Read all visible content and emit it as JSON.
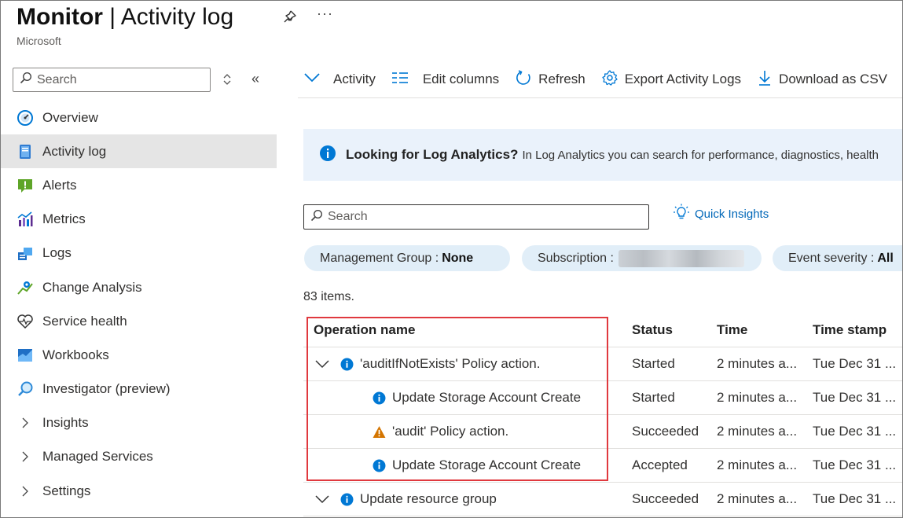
{
  "header": {
    "title_bold": "Monitor",
    "title_sep": " | ",
    "title_rest": "Activity log",
    "subtitle": "Microsoft",
    "more": "···"
  },
  "sidebar": {
    "search_placeholder": "Search",
    "collapse": "«",
    "items": [
      {
        "label": "Overview",
        "icon": "gauge-icon",
        "active": false
      },
      {
        "label": "Activity log",
        "icon": "activity-log-icon",
        "active": true
      },
      {
        "label": "Alerts",
        "icon": "alert-icon",
        "active": false
      },
      {
        "label": "Metrics",
        "icon": "metrics-icon",
        "active": false
      },
      {
        "label": "Logs",
        "icon": "logs-icon",
        "active": false
      },
      {
        "label": "Change Analysis",
        "icon": "change-analysis-icon",
        "active": false
      },
      {
        "label": "Service health",
        "icon": "heart-pulse-icon",
        "active": false
      },
      {
        "label": "Workbooks",
        "icon": "workbooks-icon",
        "active": false
      },
      {
        "label": "Investigator (preview)",
        "icon": "investigator-icon",
        "active": false
      },
      {
        "label": "Insights",
        "icon": "chevron-right-icon",
        "active": false
      },
      {
        "label": "Managed Services",
        "icon": "chevron-right-icon",
        "active": false
      },
      {
        "label": "Settings",
        "icon": "chevron-right-icon",
        "active": false
      }
    ]
  },
  "toolbar": {
    "activity": "Activity",
    "edit_columns": "Edit columns",
    "refresh": "Refresh",
    "export": "Export Activity Logs",
    "download": "Download as CSV"
  },
  "banner": {
    "bold": "Looking for Log Analytics?",
    "rest": "In Log Analytics you can search for performance, diagnostics, health"
  },
  "main": {
    "search_placeholder": "Search",
    "quick_insights": "Quick Insights",
    "filters": {
      "mgmt_label": "Management Group :",
      "mgmt_value": "None",
      "sub_label": "Subscription :",
      "sev_label": "Event severity :",
      "sev_value": "All"
    },
    "count": "83 items."
  },
  "table": {
    "columns": [
      "Operation name",
      "Status",
      "Time",
      "Time stamp"
    ],
    "rows": [
      {
        "op": "'auditIfNotExists' Policy action.",
        "status": "Started",
        "time": "2 minutes a...",
        "ts": "Tue Dec 31 ...",
        "icon": "info-icon",
        "expandable": true
      },
      {
        "op": "Update Storage Account Create",
        "status": "Started",
        "time": "2 minutes a...",
        "ts": "Tue Dec 31 ...",
        "icon": "info-icon",
        "expandable": false
      },
      {
        "op": "'audit' Policy action.",
        "status": "Succeeded",
        "time": "2 minutes a...",
        "ts": "Tue Dec 31 ...",
        "icon": "warning-icon",
        "expandable": false
      },
      {
        "op": "Update Storage Account Create",
        "status": "Accepted",
        "time": "2 minutes a...",
        "ts": "Tue Dec 31 ...",
        "icon": "info-icon",
        "expandable": false
      },
      {
        "op": "Update resource group",
        "status": "Succeeded",
        "time": "2 minutes a...",
        "ts": "Tue Dec 31 ...",
        "icon": "info-icon",
        "expandable": true
      }
    ]
  },
  "colors": {
    "accent": "#0078d4",
    "highlight": "#e0393e",
    "banner_bg": "#eaf2fb",
    "pill_bg": "#e1eef8",
    "warning": "#d47500"
  }
}
